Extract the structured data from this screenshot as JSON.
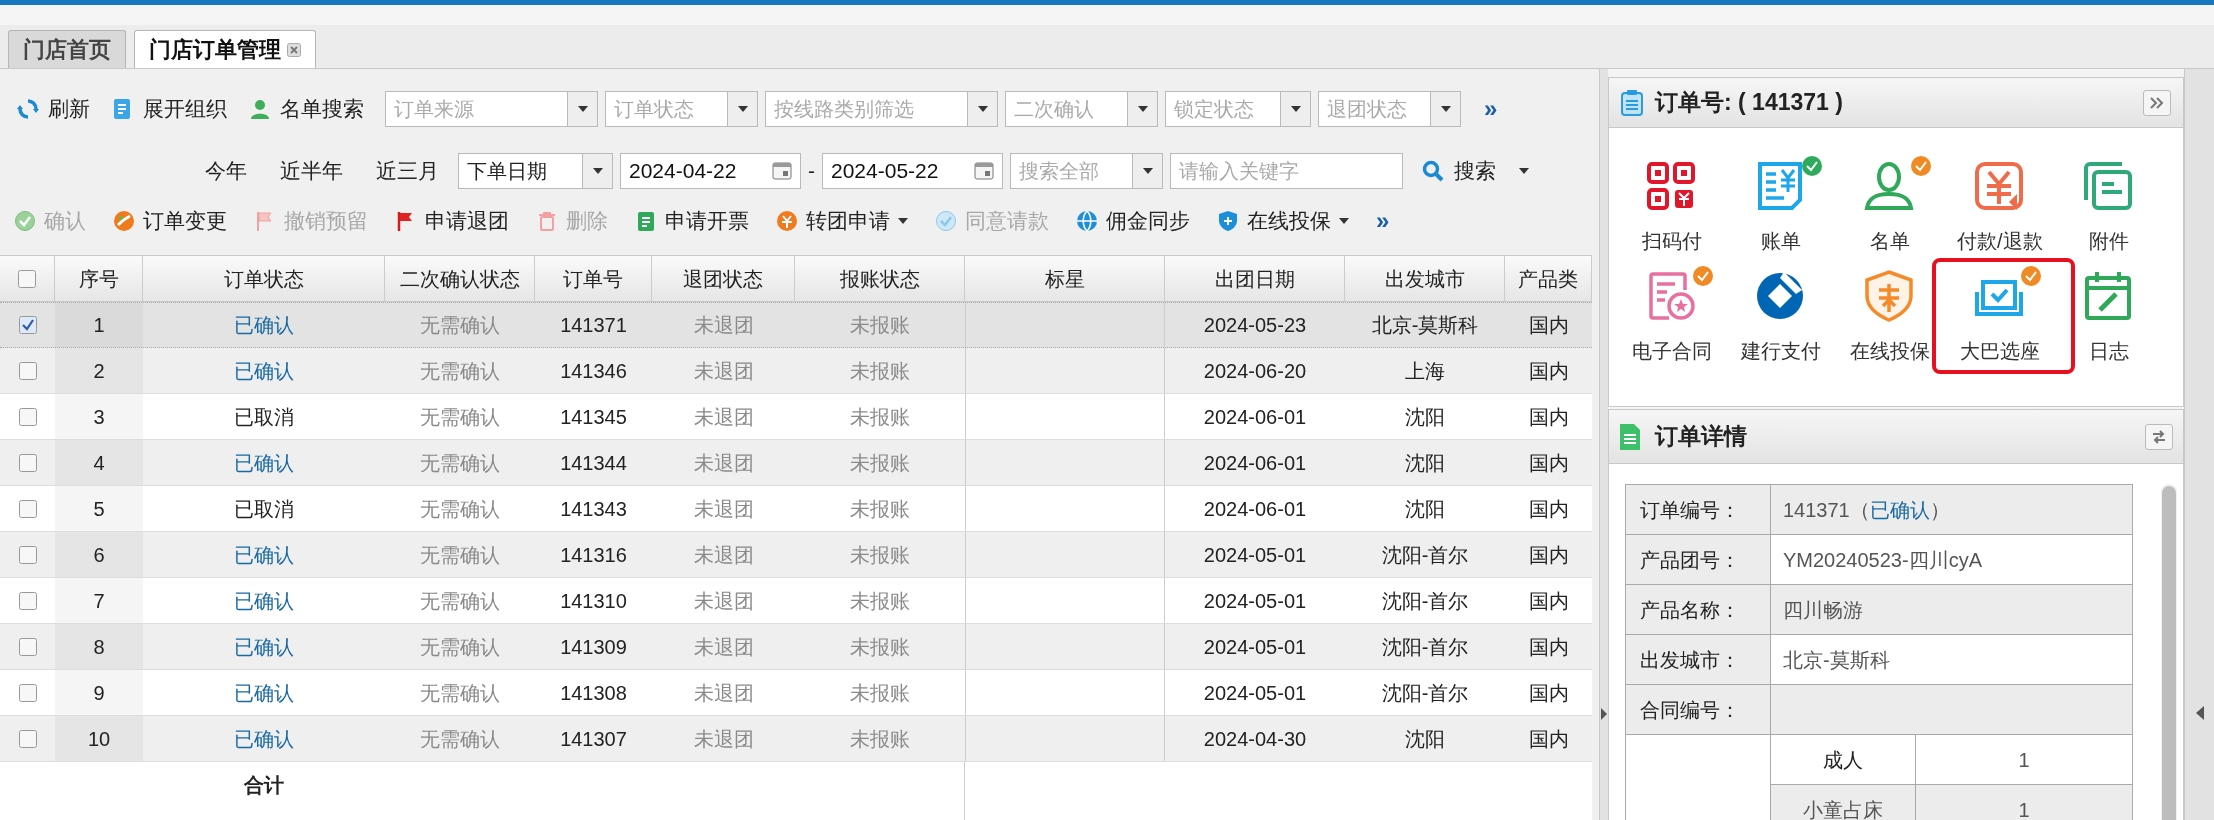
{
  "tabs": [
    {
      "label": "门店首页",
      "selected": false,
      "closable": false
    },
    {
      "label": "门店订单管理",
      "selected": true,
      "closable": true
    }
  ],
  "toolbar": {
    "buttons": [
      "刷新",
      "展开组织",
      "名单搜索"
    ],
    "filters": [
      {
        "placeholder": "订单来源"
      },
      {
        "placeholder": "订单状态"
      },
      {
        "placeholder": "按线路类别筛选"
      },
      {
        "placeholder": "二次确认"
      },
      {
        "placeholder": "锁定状态"
      },
      {
        "placeholder": "退团状态"
      }
    ],
    "more": "»"
  },
  "date_bar": {
    "quick_ranges": [
      "今年",
      "近半年",
      "近三月"
    ],
    "date_type": "下单日期",
    "date_from": "2024-04-22",
    "separator": "-",
    "date_to": "2024-05-22",
    "scope": {
      "placeholder": "搜索全部"
    },
    "keyword": {
      "placeholder": "请输入关键字"
    },
    "search_button": "搜索"
  },
  "actions": {
    "items": [
      {
        "label": "确认",
        "disabled": true,
        "dropdown": false
      },
      {
        "label": "订单变更",
        "disabled": false,
        "dropdown": false
      },
      {
        "label": "撤销预留",
        "disabled": true,
        "dropdown": false
      },
      {
        "label": "申请退团",
        "disabled": false,
        "dropdown": false
      },
      {
        "label": "删除",
        "disabled": true,
        "dropdown": false
      },
      {
        "label": "申请开票",
        "disabled": false,
        "dropdown": false
      },
      {
        "label": "转团申请",
        "disabled": false,
        "dropdown": true
      },
      {
        "label": "同意请款",
        "disabled": true,
        "dropdown": false
      },
      {
        "label": "佣金同步",
        "disabled": false,
        "dropdown": false
      },
      {
        "label": "在线投保",
        "disabled": false,
        "dropdown": true
      }
    ],
    "more": "»"
  },
  "table": {
    "header_checked": false,
    "columns": [
      "序号",
      "订单状态",
      "二次确认状态",
      "订单号",
      "退团状态",
      "报账状态",
      "标星",
      "出团日期",
      "出发城市",
      "产品类"
    ],
    "rows": [
      {
        "checked": true,
        "selected": true,
        "no": "1",
        "status": "已确认",
        "confirmed": true,
        "second_confirm": "无需确认",
        "order_no": "141371",
        "return_status": "未退团",
        "reimburse_status": "未报账",
        "departure_date": "2024-05-23",
        "city": "北京-莫斯科",
        "product_type": "国内"
      },
      {
        "checked": false,
        "selected": false,
        "no": "2",
        "status": "已确认",
        "confirmed": true,
        "second_confirm": "无需确认",
        "order_no": "141346",
        "return_status": "未退团",
        "reimburse_status": "未报账",
        "departure_date": "2024-06-20",
        "city": "上海",
        "product_type": "国内"
      },
      {
        "checked": false,
        "selected": false,
        "no": "3",
        "status": "已取消",
        "confirmed": false,
        "second_confirm": "无需确认",
        "order_no": "141345",
        "return_status": "未退团",
        "reimburse_status": "未报账",
        "departure_date": "2024-06-01",
        "city": "沈阳",
        "product_type": "国内"
      },
      {
        "checked": false,
        "selected": false,
        "no": "4",
        "status": "已确认",
        "confirmed": true,
        "second_confirm": "无需确认",
        "order_no": "141344",
        "return_status": "未退团",
        "reimburse_status": "未报账",
        "departure_date": "2024-06-01",
        "city": "沈阳",
        "product_type": "国内"
      },
      {
        "checked": false,
        "selected": false,
        "no": "5",
        "status": "已取消",
        "confirmed": false,
        "second_confirm": "无需确认",
        "order_no": "141343",
        "return_status": "未退团",
        "reimburse_status": "未报账",
        "departure_date": "2024-06-01",
        "city": "沈阳",
        "product_type": "国内"
      },
      {
        "checked": false,
        "selected": false,
        "no": "6",
        "status": "已确认",
        "confirmed": true,
        "second_confirm": "无需确认",
        "order_no": "141316",
        "return_status": "未退团",
        "reimburse_status": "未报账",
        "departure_date": "2024-05-01",
        "city": "沈阳-首尔",
        "product_type": "国内"
      },
      {
        "checked": false,
        "selected": false,
        "no": "7",
        "status": "已确认",
        "confirmed": true,
        "second_confirm": "无需确认",
        "order_no": "141310",
        "return_status": "未退团",
        "reimburse_status": "未报账",
        "departure_date": "2024-05-01",
        "city": "沈阳-首尔",
        "product_type": "国内"
      },
      {
        "checked": false,
        "selected": false,
        "no": "8",
        "status": "已确认",
        "confirmed": true,
        "second_confirm": "无需确认",
        "order_no": "141309",
        "return_status": "未退团",
        "reimburse_status": "未报账",
        "departure_date": "2024-05-01",
        "city": "沈阳-首尔",
        "product_type": "国内"
      },
      {
        "checked": false,
        "selected": false,
        "no": "9",
        "status": "已确认",
        "confirmed": true,
        "second_confirm": "无需确认",
        "order_no": "141308",
        "return_status": "未退团",
        "reimburse_status": "未报账",
        "departure_date": "2024-05-01",
        "city": "沈阳-首尔",
        "product_type": "国内"
      },
      {
        "checked": false,
        "selected": false,
        "no": "10",
        "status": "已确认",
        "confirmed": true,
        "second_confirm": "无需确认",
        "order_no": "141307",
        "return_status": "未退团",
        "reimburse_status": "未报账",
        "departure_date": "2024-04-30",
        "city": "沈阳",
        "product_type": "国内"
      }
    ],
    "total_label": "合计"
  },
  "order_panel": {
    "title": "订单号: ( 141371 )",
    "tiles": [
      {
        "label": "扫码付",
        "kind": "qrcode",
        "highlighted": false
      },
      {
        "label": "账单",
        "kind": "bill",
        "highlighted": false,
        "badge": {
          "color": "#2eaa5c"
        }
      },
      {
        "label": "名单",
        "kind": "person",
        "highlighted": false,
        "badge": {
          "color": "#f08a24"
        }
      },
      {
        "label": "付款/退款",
        "kind": "refund",
        "highlighted": false
      },
      {
        "label": "附件",
        "kind": "attachment",
        "highlighted": false
      },
      {
        "label": "电子合同",
        "kind": "contract",
        "highlighted": false,
        "badge": {
          "color": "#f08a24"
        }
      },
      {
        "label": "建行支付",
        "kind": "bank",
        "highlighted": false
      },
      {
        "label": "在线投保",
        "kind": "shield",
        "highlighted": false
      },
      {
        "label": "大巴选座",
        "kind": "seat",
        "highlighted": true,
        "badge": {
          "color": "#f08a24"
        }
      },
      {
        "label": "日志",
        "kind": "calendar",
        "highlighted": false
      }
    ]
  },
  "detail_panel": {
    "title": "订单详情",
    "rows": [
      {
        "label": "订单编号：",
        "value_parts": [
          {
            "text": "141371（",
            "kind": "plain"
          },
          {
            "text": "已确认",
            "kind": "status"
          },
          {
            "text": "）",
            "kind": "plain"
          }
        ]
      },
      {
        "label": "产品团号：",
        "value_parts": [
          {
            "text": "YM20240523-四川cyA",
            "kind": "plain"
          }
        ]
      },
      {
        "label": "产品名称：",
        "value_parts": [
          {
            "text": "四川畅游",
            "kind": "plain"
          }
        ]
      },
      {
        "label": "出发城市：",
        "value_parts": [
          {
            "text": "北京-莫斯科",
            "kind": "plain"
          }
        ]
      },
      {
        "label": "合同编号："
      }
    ],
    "people": [
      {
        "label": "成人",
        "value": "1"
      },
      {
        "label": "小童占床",
        "value": "1"
      }
    ]
  }
}
